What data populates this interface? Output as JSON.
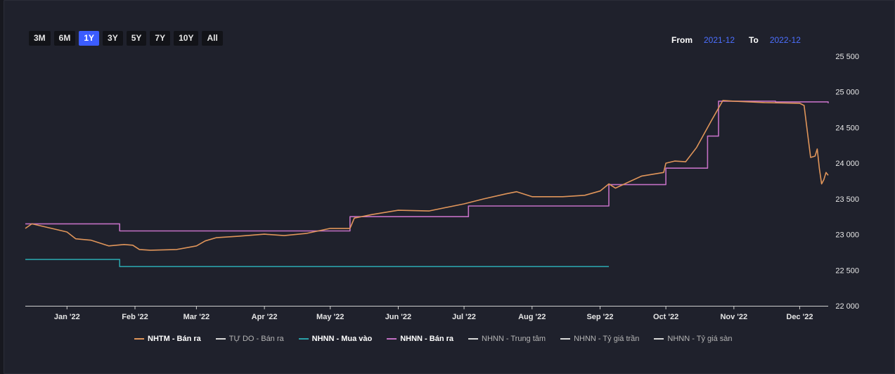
{
  "range_buttons": [
    "3M",
    "6M",
    "1Y",
    "3Y",
    "5Y",
    "7Y",
    "10Y",
    "All"
  ],
  "active_range": "1Y",
  "date_range": {
    "from_label": "From",
    "from_value": "2021-12",
    "to_label": "To",
    "to_value": "2022-12"
  },
  "chart_data": {
    "type": "line",
    "title": "",
    "xlabel": "",
    "ylabel": "",
    "x_range": [
      "2021-12-13",
      "2022-12-14"
    ],
    "ylim": [
      22000,
      25500
    ],
    "y_ticks": [
      22000,
      22500,
      23000,
      23500,
      24000,
      24500,
      25000,
      25500
    ],
    "y_tick_labels": [
      "22 000",
      "22 500",
      "23 000",
      "23 500",
      "24 000",
      "24 500",
      "25 000",
      "25 500"
    ],
    "x_ticks": [
      "2022-01-01",
      "2022-02-01",
      "2022-03-01",
      "2022-04-01",
      "2022-05-01",
      "2022-06-01",
      "2022-07-01",
      "2022-08-01",
      "2022-09-01",
      "2022-10-01",
      "2022-11-01",
      "2022-12-01"
    ],
    "x_tick_labels": [
      "Jan '22",
      "Feb '22",
      "Mar '22",
      "Apr '22",
      "May '22",
      "Jun '22",
      "Jul '22",
      "Aug '22",
      "Sep '22",
      "Oct '22",
      "Nov '22",
      "Dec '22"
    ],
    "grid": false,
    "legend_position": "bottom",
    "series": [
      {
        "name": "NHTM - Bán ra",
        "color": "#e0955a",
        "active": true,
        "step": false,
        "points": [
          [
            "2021-12-13",
            23085
          ],
          [
            "2021-12-16",
            23150
          ],
          [
            "2021-12-25",
            23085
          ],
          [
            "2022-01-01",
            23035
          ],
          [
            "2022-01-05",
            22940
          ],
          [
            "2022-01-12",
            22920
          ],
          [
            "2022-01-20",
            22840
          ],
          [
            "2022-01-27",
            22860
          ],
          [
            "2022-01-31",
            22850
          ],
          [
            "2022-02-03",
            22790
          ],
          [
            "2022-02-08",
            22780
          ],
          [
            "2022-02-20",
            22790
          ],
          [
            "2022-03-01",
            22840
          ],
          [
            "2022-03-05",
            22910
          ],
          [
            "2022-03-10",
            22955
          ],
          [
            "2022-03-20",
            22975
          ],
          [
            "2022-04-01",
            23005
          ],
          [
            "2022-04-10",
            22985
          ],
          [
            "2022-04-20",
            23015
          ],
          [
            "2022-05-01",
            23085
          ],
          [
            "2022-05-10",
            23085
          ],
          [
            "2022-05-12",
            23230
          ],
          [
            "2022-05-20",
            23280
          ],
          [
            "2022-06-01",
            23340
          ],
          [
            "2022-06-15",
            23330
          ],
          [
            "2022-07-01",
            23430
          ],
          [
            "2022-07-10",
            23500
          ],
          [
            "2022-07-20",
            23570
          ],
          [
            "2022-07-25",
            23600
          ],
          [
            "2022-08-01",
            23530
          ],
          [
            "2022-08-15",
            23530
          ],
          [
            "2022-08-25",
            23550
          ],
          [
            "2022-09-01",
            23610
          ],
          [
            "2022-09-05",
            23710
          ],
          [
            "2022-09-08",
            23650
          ],
          [
            "2022-09-15",
            23750
          ],
          [
            "2022-09-20",
            23820
          ],
          [
            "2022-09-30",
            23870
          ],
          [
            "2022-10-01",
            24000
          ],
          [
            "2022-10-05",
            24030
          ],
          [
            "2022-10-10",
            24020
          ],
          [
            "2022-10-15",
            24220
          ],
          [
            "2022-10-22",
            24610
          ],
          [
            "2022-10-27",
            24880
          ],
          [
            "2022-11-01",
            24870
          ],
          [
            "2022-11-15",
            24850
          ],
          [
            "2022-12-01",
            24840
          ],
          [
            "2022-12-03",
            24810
          ],
          [
            "2022-12-05",
            24320
          ],
          [
            "2022-12-06",
            24080
          ],
          [
            "2022-12-08",
            24100
          ],
          [
            "2022-12-09",
            24200
          ],
          [
            "2022-12-10",
            23920
          ],
          [
            "2022-12-11",
            23710
          ],
          [
            "2022-12-12",
            23770
          ],
          [
            "2022-12-13",
            23870
          ],
          [
            "2022-12-14",
            23830
          ]
        ]
      },
      {
        "name": "TỰ DO - Bán ra",
        "color": "#d9d9d9",
        "active": false,
        "step": true,
        "points": []
      },
      {
        "name": "NHNN - Mua vào",
        "color": "#2aa1a8",
        "active": true,
        "step": true,
        "points": [
          [
            "2021-12-13",
            22650
          ],
          [
            "2022-01-25",
            22550
          ],
          [
            "2022-09-05",
            22550
          ]
        ]
      },
      {
        "name": "NHNN - Bán ra",
        "color": "#c370c4",
        "active": true,
        "step": true,
        "points": [
          [
            "2021-12-13",
            23150
          ],
          [
            "2022-01-25",
            23050
          ],
          [
            "2022-05-10",
            23250
          ],
          [
            "2022-07-03",
            23400
          ],
          [
            "2022-09-05",
            23700
          ],
          [
            "2022-10-01",
            23930
          ],
          [
            "2022-10-20",
            24380
          ],
          [
            "2022-10-25",
            24870
          ],
          [
            "2022-11-20",
            24860
          ],
          [
            "2022-12-14",
            24840
          ]
        ]
      },
      {
        "name": "NHNN - Trung tâm",
        "color": "#d9d9d9",
        "active": false,
        "step": true,
        "points": []
      },
      {
        "name": "NHNN - Tỷ giá trần",
        "color": "#d9d9d9",
        "active": false,
        "step": true,
        "points": []
      },
      {
        "name": "NHNN - Tỷ giá sàn",
        "color": "#d9d9d9",
        "active": false,
        "step": true,
        "points": []
      }
    ]
  }
}
